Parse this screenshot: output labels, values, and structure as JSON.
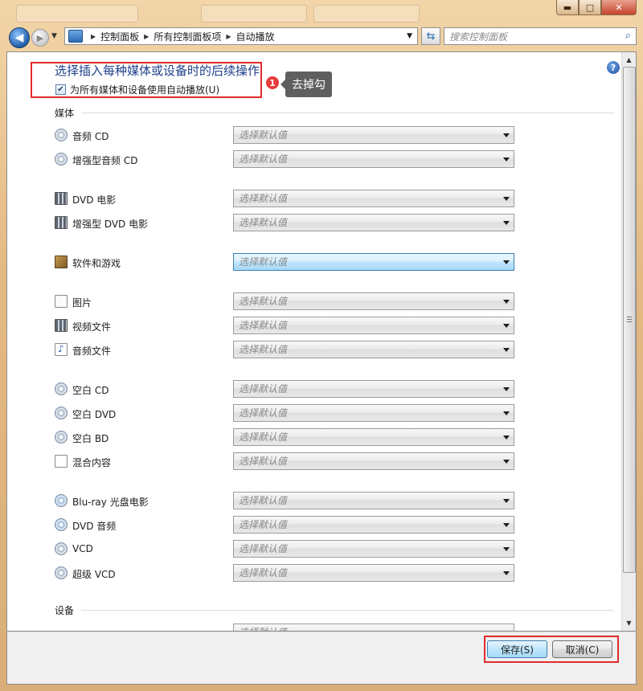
{
  "window": {
    "caption": {
      "minimize": "▬",
      "maximize": "□",
      "close": "✕"
    }
  },
  "nav": {
    "breadcrumbs": [
      "控制面板",
      "所有控制面板项",
      "自动播放"
    ],
    "search_placeholder": "搜索控制面板"
  },
  "header": {
    "title": "选择插入每种媒体或设备时的后续操作",
    "autoplay_checkbox_label": "为所有媒体和设备使用自动播放(U)",
    "autoplay_checked": true,
    "help": "?"
  },
  "annotation": {
    "number": "1",
    "text": "去掉勾"
  },
  "sections": {
    "media_title": "媒体",
    "device_title": "设备"
  },
  "select_placeholder": "选择默认值",
  "media_items": [
    {
      "label": "音频 CD",
      "icon": "audio-cd-icon"
    },
    {
      "label": "增强型音频 CD",
      "icon": "enhanced-audio-cd-icon"
    },
    {
      "label": "DVD 电影",
      "icon": "dvd-movie-icon"
    },
    {
      "label": "增强型 DVD 电影",
      "icon": "enhanced-dvd-movie-icon"
    },
    {
      "label": "软件和游戏",
      "icon": "software-games-icon"
    },
    {
      "label": "图片",
      "icon": "pictures-icon"
    },
    {
      "label": "视频文件",
      "icon": "video-files-icon"
    },
    {
      "label": "音频文件",
      "icon": "audio-files-icon"
    },
    {
      "label": "空白 CD",
      "icon": "blank-cd-icon"
    },
    {
      "label": "空白 DVD",
      "icon": "blank-dvd-icon"
    },
    {
      "label": "空白 BD",
      "icon": "blank-bd-icon"
    },
    {
      "label": "混合内容",
      "icon": "mixed-content-icon"
    },
    {
      "label": "Blu-ray 光盘电影",
      "icon": "bluray-movie-icon"
    },
    {
      "label": "DVD 音频",
      "icon": "dvd-audio-icon"
    },
    {
      "label": "VCD",
      "icon": "vcd-icon"
    },
    {
      "label": "超级 VCD",
      "icon": "super-vcd-icon"
    }
  ],
  "footer": {
    "save_label": "保存(S)",
    "cancel_label": "取消(C)"
  },
  "colors": {
    "heading": "#1e3f8a",
    "annotation_red": "#e02b2b"
  }
}
